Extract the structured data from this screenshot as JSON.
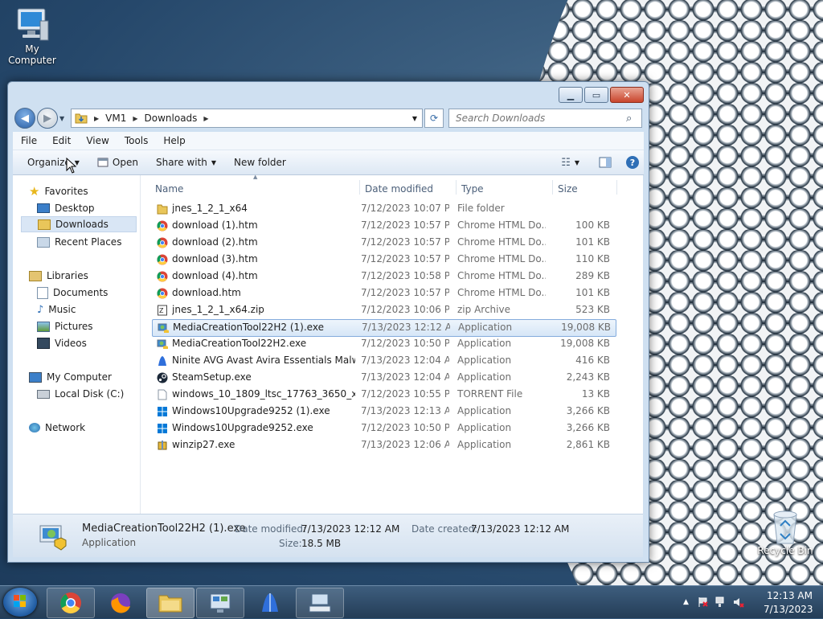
{
  "desktop": {
    "my_computer_label": "My Computer",
    "recycle_bin_label": "Recycle Bin"
  },
  "window": {
    "address": {
      "segments": [
        "VM1",
        "Downloads"
      ]
    },
    "search_placeholder": "Search Downloads",
    "menu": [
      "File",
      "Edit",
      "View",
      "Tools",
      "Help"
    ],
    "commands": {
      "organize": "Organize",
      "open": "Open",
      "share_with": "Share with",
      "new_folder": "New folder"
    }
  },
  "nav": {
    "favorites": "Favorites",
    "desktop": "Desktop",
    "downloads": "Downloads",
    "recent_places": "Recent Places",
    "libraries": "Libraries",
    "documents": "Documents",
    "music": "Music",
    "pictures": "Pictures",
    "videos": "Videos",
    "my_computer": "My Computer",
    "local_disk": "Local Disk (C:)",
    "network": "Network"
  },
  "columns": {
    "name": "Name",
    "date": "Date modified",
    "type": "Type",
    "size": "Size"
  },
  "files": [
    {
      "name": "jnes_1_2_1_x64",
      "date": "7/12/2023 10:07 PM",
      "type": "File folder",
      "size": "",
      "icon": "folder-icon"
    },
    {
      "name": "download (1).htm",
      "date": "7/12/2023 10:57 PM",
      "type": "Chrome HTML Do...",
      "size": "100 KB",
      "icon": "chrome-icon"
    },
    {
      "name": "download (2).htm",
      "date": "7/12/2023 10:57 PM",
      "type": "Chrome HTML Do...",
      "size": "101 KB",
      "icon": "chrome-icon"
    },
    {
      "name": "download (3).htm",
      "date": "7/12/2023 10:57 PM",
      "type": "Chrome HTML Do...",
      "size": "110 KB",
      "icon": "chrome-icon"
    },
    {
      "name": "download (4).htm",
      "date": "7/12/2023 10:58 PM",
      "type": "Chrome HTML Do...",
      "size": "289 KB",
      "icon": "chrome-icon"
    },
    {
      "name": "download.htm",
      "date": "7/12/2023 10:57 PM",
      "type": "Chrome HTML Do...",
      "size": "101 KB",
      "icon": "chrome-icon"
    },
    {
      "name": "jnes_1_2_1_x64.zip",
      "date": "7/12/2023 10:06 PM",
      "type": "zip Archive",
      "size": "523 KB",
      "icon": "zip-icon"
    },
    {
      "name": "MediaCreationTool22H2 (1).exe",
      "date": "7/13/2023 12:12 AM",
      "type": "Application",
      "size": "19,008 KB",
      "icon": "media-tool-icon"
    },
    {
      "name": "MediaCreationTool22H2.exe",
      "date": "7/12/2023 10:50 PM",
      "type": "Application",
      "size": "19,008 KB",
      "icon": "media-tool-icon"
    },
    {
      "name": "Ninite AVG Avast Avira Essentials Malwar...",
      "date": "7/13/2023 12:04 AM",
      "type": "Application",
      "size": "416 KB",
      "icon": "ninite-icon"
    },
    {
      "name": "SteamSetup.exe",
      "date": "7/13/2023 12:04 AM",
      "type": "Application",
      "size": "2,243 KB",
      "icon": "steam-icon"
    },
    {
      "name": "windows_10_1809_ltsc_17763_3650_x64_r...",
      "date": "7/12/2023 10:55 PM",
      "type": "TORRENT File",
      "size": "13 KB",
      "icon": "file-icon"
    },
    {
      "name": "Windows10Upgrade9252 (1).exe",
      "date": "7/13/2023 12:13 AM",
      "type": "Application",
      "size": "3,266 KB",
      "icon": "windows-icon"
    },
    {
      "name": "Windows10Upgrade9252.exe",
      "date": "7/12/2023 10:50 PM",
      "type": "Application",
      "size": "3,266 KB",
      "icon": "windows-icon"
    },
    {
      "name": "winzip27.exe",
      "date": "7/13/2023 12:06 AM",
      "type": "Application",
      "size": "2,861 KB",
      "icon": "winzip-icon"
    }
  ],
  "details": {
    "file_name": "MediaCreationTool22H2 (1).exe",
    "file_type": "Application",
    "modified_label": "Date modified:",
    "modified_value": "7/13/2023 12:12 AM",
    "created_label": "Date created:",
    "created_value": "7/13/2023 12:12 AM",
    "size_label": "Size:",
    "size_value": "18.5 MB"
  },
  "tray": {
    "time": "12:13 AM",
    "date": "7/13/2023"
  },
  "colors": {
    "selection_border": "#84acdd",
    "taskbar": "#2e4a66"
  }
}
